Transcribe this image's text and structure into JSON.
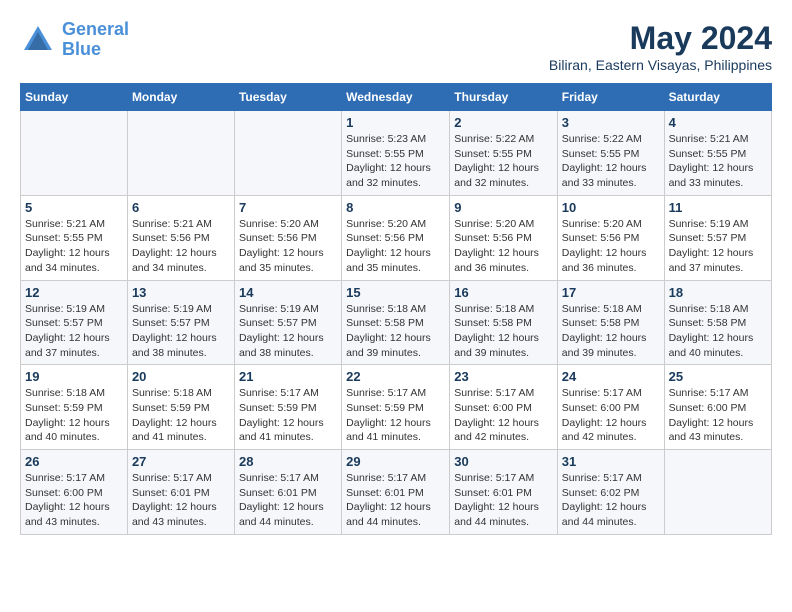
{
  "header": {
    "logo_line1": "General",
    "logo_line2": "Blue",
    "title": "May 2024",
    "subtitle": "Biliran, Eastern Visayas, Philippines"
  },
  "days_of_week": [
    "Sunday",
    "Monday",
    "Tuesday",
    "Wednesday",
    "Thursday",
    "Friday",
    "Saturday"
  ],
  "weeks": [
    [
      {
        "day": "",
        "info": ""
      },
      {
        "day": "",
        "info": ""
      },
      {
        "day": "",
        "info": ""
      },
      {
        "day": "1",
        "info": "Sunrise: 5:23 AM\nSunset: 5:55 PM\nDaylight: 12 hours\nand 32 minutes."
      },
      {
        "day": "2",
        "info": "Sunrise: 5:22 AM\nSunset: 5:55 PM\nDaylight: 12 hours\nand 32 minutes."
      },
      {
        "day": "3",
        "info": "Sunrise: 5:22 AM\nSunset: 5:55 PM\nDaylight: 12 hours\nand 33 minutes."
      },
      {
        "day": "4",
        "info": "Sunrise: 5:21 AM\nSunset: 5:55 PM\nDaylight: 12 hours\nand 33 minutes."
      }
    ],
    [
      {
        "day": "5",
        "info": "Sunrise: 5:21 AM\nSunset: 5:55 PM\nDaylight: 12 hours\nand 34 minutes."
      },
      {
        "day": "6",
        "info": "Sunrise: 5:21 AM\nSunset: 5:56 PM\nDaylight: 12 hours\nand 34 minutes."
      },
      {
        "day": "7",
        "info": "Sunrise: 5:20 AM\nSunset: 5:56 PM\nDaylight: 12 hours\nand 35 minutes."
      },
      {
        "day": "8",
        "info": "Sunrise: 5:20 AM\nSunset: 5:56 PM\nDaylight: 12 hours\nand 35 minutes."
      },
      {
        "day": "9",
        "info": "Sunrise: 5:20 AM\nSunset: 5:56 PM\nDaylight: 12 hours\nand 36 minutes."
      },
      {
        "day": "10",
        "info": "Sunrise: 5:20 AM\nSunset: 5:56 PM\nDaylight: 12 hours\nand 36 minutes."
      },
      {
        "day": "11",
        "info": "Sunrise: 5:19 AM\nSunset: 5:57 PM\nDaylight: 12 hours\nand 37 minutes."
      }
    ],
    [
      {
        "day": "12",
        "info": "Sunrise: 5:19 AM\nSunset: 5:57 PM\nDaylight: 12 hours\nand 37 minutes."
      },
      {
        "day": "13",
        "info": "Sunrise: 5:19 AM\nSunset: 5:57 PM\nDaylight: 12 hours\nand 38 minutes."
      },
      {
        "day": "14",
        "info": "Sunrise: 5:19 AM\nSunset: 5:57 PM\nDaylight: 12 hours\nand 38 minutes."
      },
      {
        "day": "15",
        "info": "Sunrise: 5:18 AM\nSunset: 5:58 PM\nDaylight: 12 hours\nand 39 minutes."
      },
      {
        "day": "16",
        "info": "Sunrise: 5:18 AM\nSunset: 5:58 PM\nDaylight: 12 hours\nand 39 minutes."
      },
      {
        "day": "17",
        "info": "Sunrise: 5:18 AM\nSunset: 5:58 PM\nDaylight: 12 hours\nand 39 minutes."
      },
      {
        "day": "18",
        "info": "Sunrise: 5:18 AM\nSunset: 5:58 PM\nDaylight: 12 hours\nand 40 minutes."
      }
    ],
    [
      {
        "day": "19",
        "info": "Sunrise: 5:18 AM\nSunset: 5:59 PM\nDaylight: 12 hours\nand 40 minutes."
      },
      {
        "day": "20",
        "info": "Sunrise: 5:18 AM\nSunset: 5:59 PM\nDaylight: 12 hours\nand 41 minutes."
      },
      {
        "day": "21",
        "info": "Sunrise: 5:17 AM\nSunset: 5:59 PM\nDaylight: 12 hours\nand 41 minutes."
      },
      {
        "day": "22",
        "info": "Sunrise: 5:17 AM\nSunset: 5:59 PM\nDaylight: 12 hours\nand 41 minutes."
      },
      {
        "day": "23",
        "info": "Sunrise: 5:17 AM\nSunset: 6:00 PM\nDaylight: 12 hours\nand 42 minutes."
      },
      {
        "day": "24",
        "info": "Sunrise: 5:17 AM\nSunset: 6:00 PM\nDaylight: 12 hours\nand 42 minutes."
      },
      {
        "day": "25",
        "info": "Sunrise: 5:17 AM\nSunset: 6:00 PM\nDaylight: 12 hours\nand 43 minutes."
      }
    ],
    [
      {
        "day": "26",
        "info": "Sunrise: 5:17 AM\nSunset: 6:00 PM\nDaylight: 12 hours\nand 43 minutes."
      },
      {
        "day": "27",
        "info": "Sunrise: 5:17 AM\nSunset: 6:01 PM\nDaylight: 12 hours\nand 43 minutes."
      },
      {
        "day": "28",
        "info": "Sunrise: 5:17 AM\nSunset: 6:01 PM\nDaylight: 12 hours\nand 44 minutes."
      },
      {
        "day": "29",
        "info": "Sunrise: 5:17 AM\nSunset: 6:01 PM\nDaylight: 12 hours\nand 44 minutes."
      },
      {
        "day": "30",
        "info": "Sunrise: 5:17 AM\nSunset: 6:01 PM\nDaylight: 12 hours\nand 44 minutes."
      },
      {
        "day": "31",
        "info": "Sunrise: 5:17 AM\nSunset: 6:02 PM\nDaylight: 12 hours\nand 44 minutes."
      },
      {
        "day": "",
        "info": ""
      }
    ]
  ]
}
